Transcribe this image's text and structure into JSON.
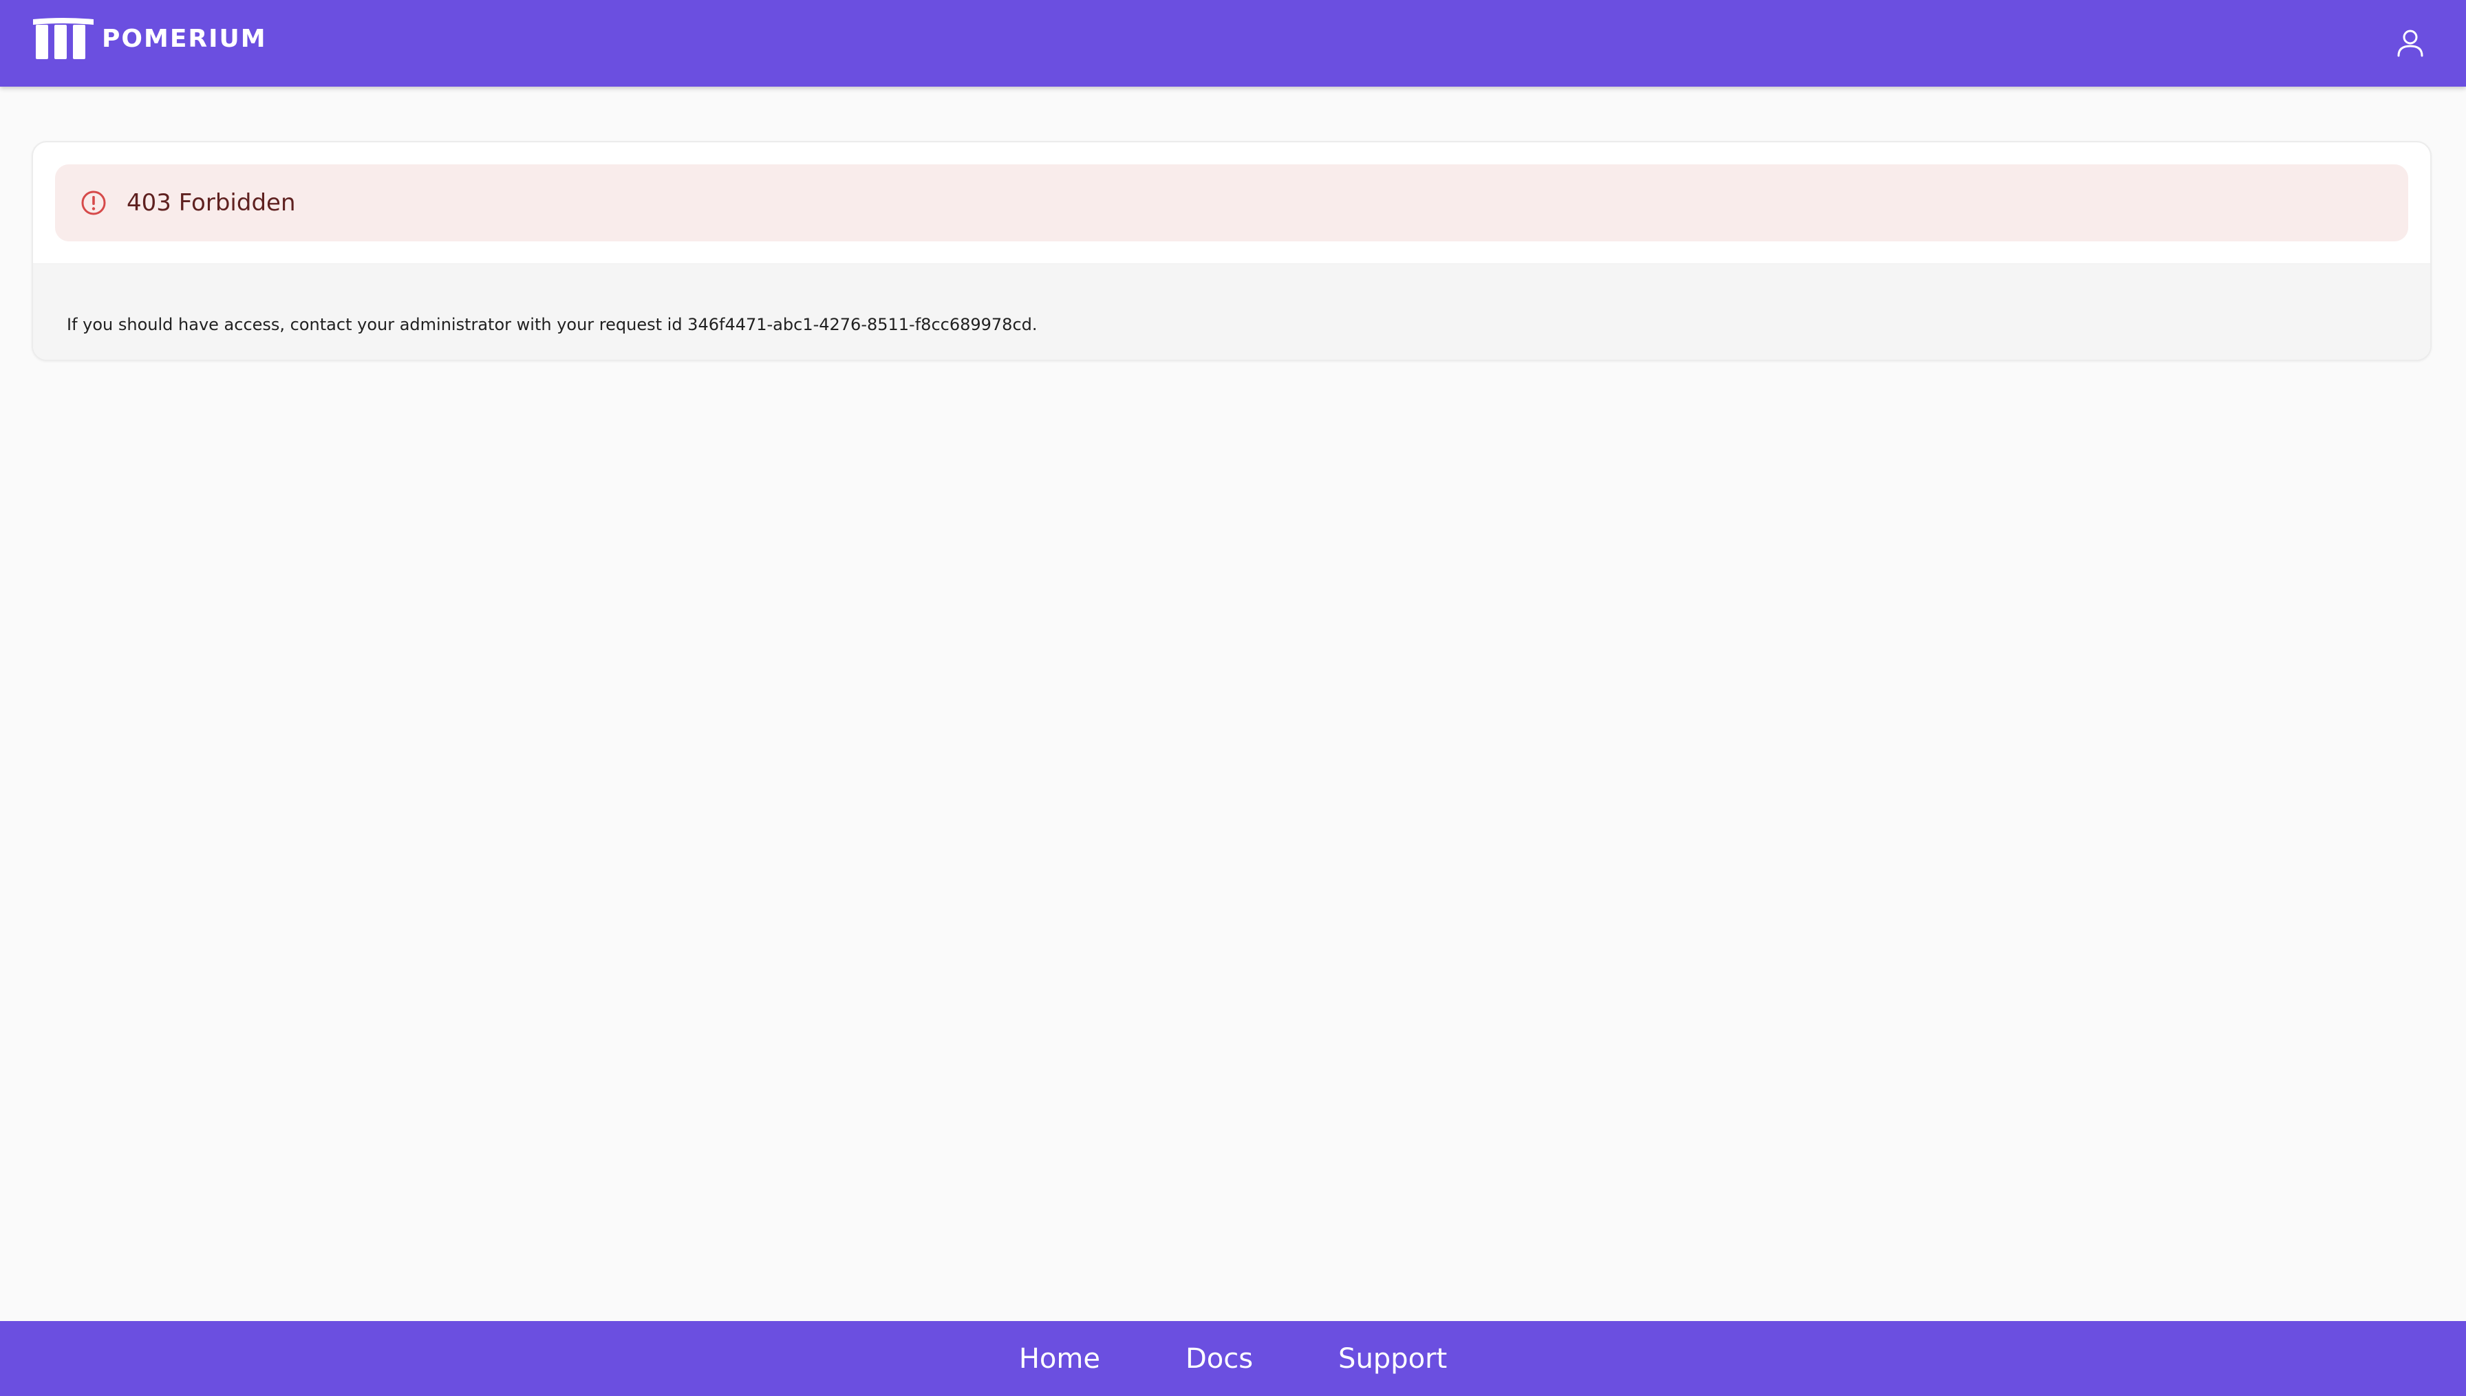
{
  "header": {
    "brand_name": "POMERIUM",
    "logo_icon": "pomerium-columns-icon",
    "user_icon": "user-icon"
  },
  "alert": {
    "severity": "error",
    "icon": "error-circle-icon",
    "title": "403 Forbidden",
    "icon_color": "#d64a4a",
    "background_color": "#f9eceb"
  },
  "body": {
    "message": "If you should have access, contact your administrator with your request id 346f4471-abc1-4276-8511-f8cc689978cd."
  },
  "footer": {
    "links": [
      {
        "label": "Home"
      },
      {
        "label": "Docs"
      },
      {
        "label": "Support"
      }
    ]
  },
  "colors": {
    "brand": "#6b4fe0",
    "page_background": "#fafafa"
  }
}
